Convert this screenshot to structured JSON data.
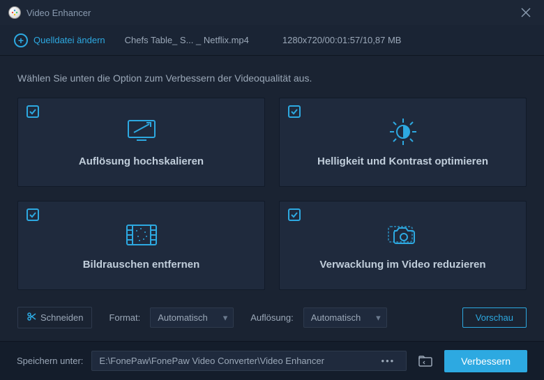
{
  "titlebar": {
    "title": "Video Enhancer"
  },
  "subbar": {
    "change_source": "Quelldatei ändern",
    "filename": "Chefs Table_ S... _ Netflix.mp4",
    "meta": "1280x720/00:01:57/10,87 MB"
  },
  "main": {
    "prompt": "Wählen Sie unten die Option zum Verbessern der Videoqualität aus.",
    "cards": [
      {
        "label": "Auflösung hochskalieren",
        "checked": true
      },
      {
        "label": "Helligkeit und Kontrast optimieren",
        "checked": true
      },
      {
        "label": "Bildrauschen entfernen",
        "checked": true
      },
      {
        "label": "Verwacklung im Video reduzieren",
        "checked": true
      }
    ]
  },
  "controls": {
    "cut": "Schneiden",
    "format_label": "Format:",
    "format_value": "Automatisch",
    "resolution_label": "Auflösung:",
    "resolution_value": "Automatisch",
    "preview": "Vorschau"
  },
  "footer": {
    "save_label": "Speichern unter:",
    "path": "E:\\FonePaw\\FonePaw Video Converter\\Video Enhancer",
    "enhance": "Verbessern"
  },
  "colors": {
    "accent": "#2da9e1",
    "panel": "#1f2a3d",
    "bg": "#1a2332"
  }
}
